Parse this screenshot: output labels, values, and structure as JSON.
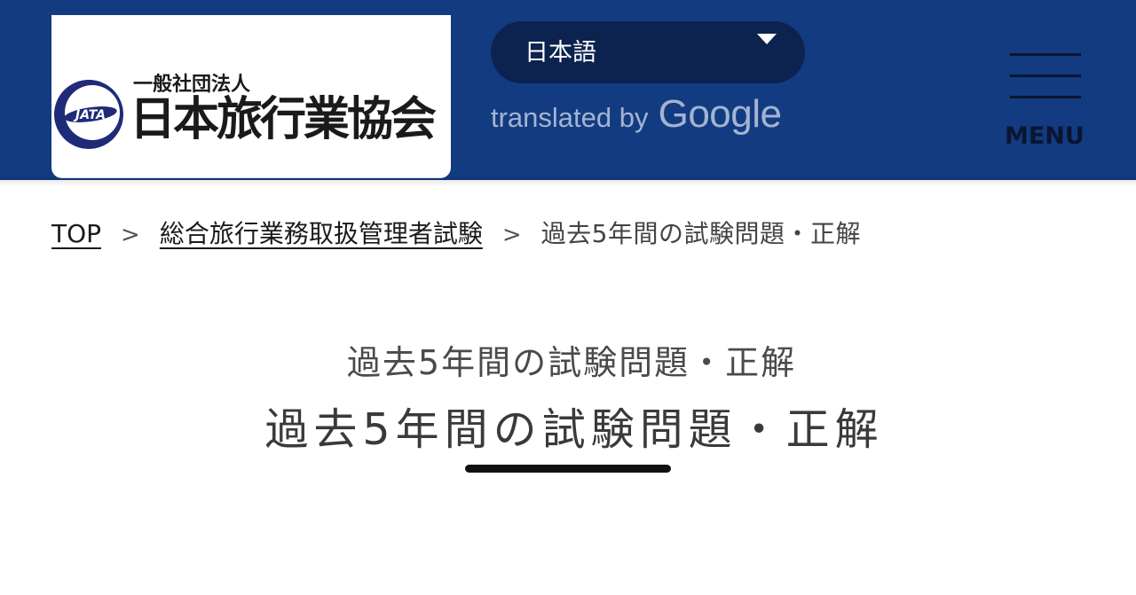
{
  "header": {
    "logo": {
      "emblem_text": "JATA",
      "org_type": "一般社団法人",
      "org_name": "日本旅行業協会"
    },
    "language_select": {
      "selected": "日本語"
    },
    "translated_by": {
      "prefix": "translated by",
      "brand": "Google"
    },
    "menu": {
      "label": "MENU"
    },
    "colors": {
      "header_bg": "#123b82",
      "select_bg": "#0c234f"
    }
  },
  "breadcrumb": {
    "items": [
      {
        "label": "TOP"
      },
      {
        "label": "総合旅行業務取扱管理者試験"
      },
      {
        "label": "過去5年間の試験問題・正解"
      }
    ],
    "separator": ">"
  },
  "main": {
    "title_small": "過去5年間の試験問題・正解",
    "title": "過去5年間の試験問題・正解"
  }
}
